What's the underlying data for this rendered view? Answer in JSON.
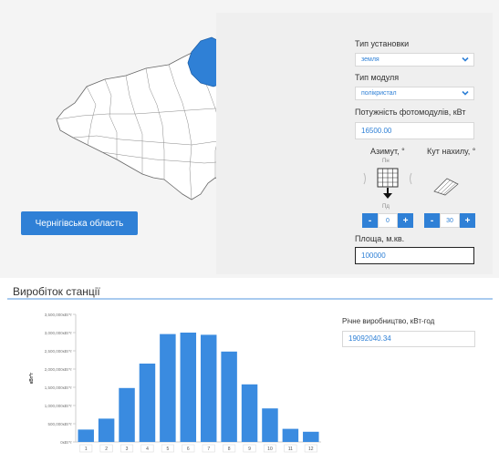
{
  "map": {
    "selected_region_button": "Чернігівська область",
    "highlight_color": "#2f80d6"
  },
  "settings": {
    "install_type_label": "Тип установки",
    "install_type_value": "земля",
    "module_type_label": "Тип модуля",
    "module_type_value": "полікристал",
    "power_label": "Потужність фотомодулів, кВт",
    "power_value": "16500.00",
    "azimuth_label": "Азимут, °",
    "tilt_label": "Кут нахилу, °",
    "compass_north": "Пн",
    "compass_south": "Пд",
    "azimuth_value": "0",
    "tilt_value": "30",
    "minus_label": "-",
    "plus_label": "+",
    "area_label": "Площа, м.кв.",
    "area_value": "100000"
  },
  "production": {
    "section_title": "Виробіток станції",
    "annual_label": "Річне виробництво, кВт-год",
    "annual_value": "19092040.34"
  },
  "chart_data": {
    "type": "bar",
    "categories": [
      "1",
      "2",
      "3",
      "4",
      "5",
      "6",
      "7",
      "8",
      "9",
      "10",
      "11",
      "12"
    ],
    "values": [
      340000,
      640000,
      1480000,
      2150000,
      2960000,
      3000000,
      2940000,
      2480000,
      1580000,
      920000,
      360000,
      280000
    ],
    "ylabel": "кВт*г",
    "ylim": [
      0,
      3500000
    ],
    "yticks": [
      "0кВт*г",
      "500,000кВт*г",
      "1,000,000кВт*г",
      "1,500,000кВт*г",
      "2,000,000кВт*г",
      "2,500,000кВт*г",
      "3,000,000кВт*г",
      "3,500,000кВт*г"
    ],
    "bar_color": "#3a8be0",
    "grid": false
  }
}
